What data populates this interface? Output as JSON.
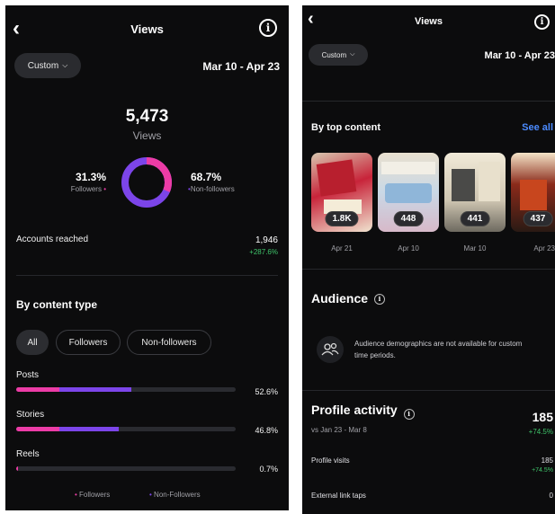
{
  "left": {
    "header": {
      "back_icon": "chevron-left-icon",
      "title": "Views",
      "info_icon": "info-icon"
    },
    "filter": {
      "range_label": "Custom",
      "date_range": "Mar 10 - Apr 23"
    },
    "summary": {
      "total": "5,473",
      "total_label": "Views",
      "followers_pct": "31.3%",
      "followers_label": "Followers",
      "non_followers_pct": "68.7%",
      "non_followers_label": "Non-followers",
      "followers_fraction": 0.313
    },
    "accounts_reached": {
      "label": "Accounts reached",
      "value": "1,946",
      "change": "+287.6%"
    },
    "content_type": {
      "heading": "By content type",
      "chips": [
        "All",
        "Followers",
        "Non-followers"
      ],
      "rows": [
        {
          "label": "Posts",
          "pct": "52.6%",
          "followers": 0.196,
          "non_followers": 0.33
        },
        {
          "label": "Stories",
          "pct": "46.8%",
          "followers": 0.196,
          "non_followers": 0.272
        },
        {
          "label": "Reels",
          "pct": "0.7%",
          "followers": 0.007,
          "non_followers": 0.0
        }
      ],
      "legend": [
        "Followers",
        "Non-Followers"
      ]
    },
    "colors": {
      "followers": "#ec3ca6",
      "non_followers": "#7c45e9"
    }
  },
  "right": {
    "header": {
      "back_icon": "chevron-left-icon",
      "title": "Views",
      "info_icon": "info-icon"
    },
    "filter": {
      "range_label": "Custom",
      "date_range": "Mar 10 - Apr 23"
    },
    "top_content": {
      "heading": "By top content",
      "see_all": "See all",
      "items": [
        {
          "count": "1.8K",
          "date": "Apr 21"
        },
        {
          "count": "448",
          "date": "Apr 10"
        },
        {
          "count": "441",
          "date": "Mar 10"
        },
        {
          "count": "437",
          "date": "Apr 23"
        }
      ]
    },
    "audience": {
      "heading": "Audience",
      "message": "Audience demographics are not available for custom time periods."
    },
    "profile_activity": {
      "heading": "Profile activity",
      "compare": "vs Jan 23 - Mar 8",
      "total": "185",
      "total_change": "+74.5%",
      "visits_label": "Profile visits",
      "visits_value": "185",
      "visits_change": "+74.5%",
      "link_taps_label": "External link taps",
      "link_taps_value": "0"
    }
  }
}
